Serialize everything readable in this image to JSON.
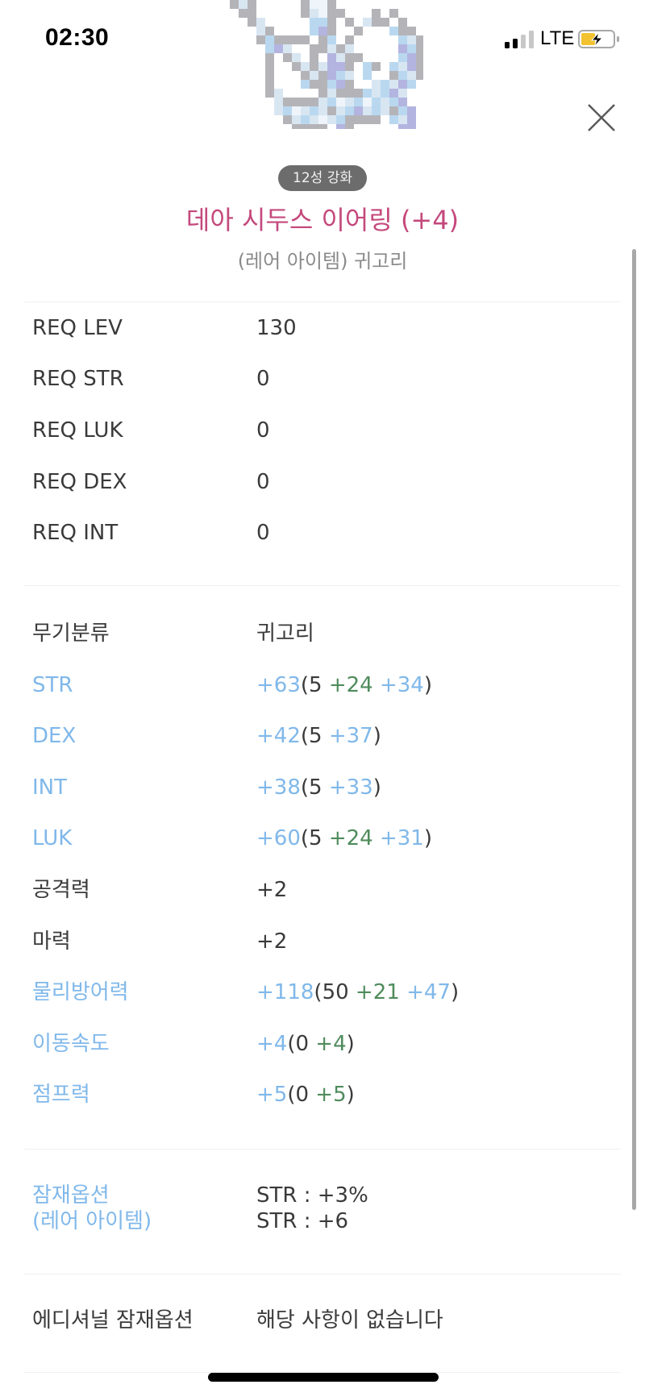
{
  "status_bar": {
    "time": "02:30",
    "network": "LTE",
    "signal_bars_active": 2,
    "signal_bars_total": 4,
    "battery_state": "charging"
  },
  "item": {
    "image_icon": "pixel-earring-icon",
    "enhance_badge": "12성 강화",
    "name": "데아 시두스 이어링 (+4)",
    "subtitle": "(레어 아이템) 귀고리"
  },
  "close_icon": "close-x-icon",
  "requirements": [
    {
      "label": "REQ LEV",
      "value": "130"
    },
    {
      "label": "REQ STR",
      "value": "0"
    },
    {
      "label": "REQ LUK",
      "value": "0"
    },
    {
      "label": "REQ DEX",
      "value": "0"
    },
    {
      "label": "REQ INT",
      "value": "0"
    }
  ],
  "stats": [
    {
      "label": "무기분류",
      "label_color": "dark",
      "parts": [
        {
          "text": "귀고리",
          "color": "dark"
        }
      ]
    },
    {
      "label": "STR",
      "label_color": "blue",
      "parts": [
        {
          "text": "+63",
          "color": "blue"
        },
        {
          "text": "(5 ",
          "color": "dark"
        },
        {
          "text": "+24",
          "color": "green"
        },
        {
          "text": " ",
          "color": "dark"
        },
        {
          "text": "+34",
          "color": "blue"
        },
        {
          "text": ")",
          "color": "dark"
        }
      ]
    },
    {
      "label": "DEX",
      "label_color": "blue",
      "parts": [
        {
          "text": "+42",
          "color": "blue"
        },
        {
          "text": "(5 ",
          "color": "dark"
        },
        {
          "text": "+37",
          "color": "blue"
        },
        {
          "text": ")",
          "color": "dark"
        }
      ]
    },
    {
      "label": "INT",
      "label_color": "blue",
      "parts": [
        {
          "text": "+38",
          "color": "blue"
        },
        {
          "text": "(5 ",
          "color": "dark"
        },
        {
          "text": "+33",
          "color": "blue"
        },
        {
          "text": ")",
          "color": "dark"
        }
      ]
    },
    {
      "label": "LUK",
      "label_color": "blue",
      "parts": [
        {
          "text": "+60",
          "color": "blue"
        },
        {
          "text": "(5 ",
          "color": "dark"
        },
        {
          "text": "+24",
          "color": "green"
        },
        {
          "text": " ",
          "color": "dark"
        },
        {
          "text": "+31",
          "color": "blue"
        },
        {
          "text": ")",
          "color": "dark"
        }
      ]
    },
    {
      "label": "공격력",
      "label_color": "dark",
      "parts": [
        {
          "text": "+2",
          "color": "dark"
        }
      ]
    },
    {
      "label": "마력",
      "label_color": "dark",
      "parts": [
        {
          "text": "+2",
          "color": "dark"
        }
      ]
    },
    {
      "label": "물리방어력",
      "label_color": "blue",
      "parts": [
        {
          "text": "+118",
          "color": "blue"
        },
        {
          "text": "(50 ",
          "color": "dark"
        },
        {
          "text": "+21",
          "color": "green"
        },
        {
          "text": " ",
          "color": "dark"
        },
        {
          "text": "+47",
          "color": "blue"
        },
        {
          "text": ")",
          "color": "dark"
        }
      ]
    },
    {
      "label": "이동속도",
      "label_color": "blue",
      "parts": [
        {
          "text": "+4",
          "color": "blue"
        },
        {
          "text": "(0 ",
          "color": "dark"
        },
        {
          "text": "+4",
          "color": "green"
        },
        {
          "text": ")",
          "color": "dark"
        }
      ]
    },
    {
      "label": "점프력",
      "label_color": "blue",
      "parts": [
        {
          "text": "+5",
          "color": "blue"
        },
        {
          "text": "(0 ",
          "color": "dark"
        },
        {
          "text": "+5",
          "color": "green"
        },
        {
          "text": ")",
          "color": "dark"
        }
      ]
    }
  ],
  "potential": {
    "label_line1": "잠재옵션",
    "label_line2": "(레어 아이템)",
    "lines": [
      "STR : +3%",
      "STR : +6"
    ]
  },
  "additional_potential": {
    "label": "에디셔널 잠재옵션",
    "value": "해당 사항이 없습니다"
  },
  "colors": {
    "title": "#c4497c",
    "blue": "#80b8ea",
    "green": "#4f8c5c",
    "red": "#e23b3b",
    "dark": "#3a3a3a",
    "badge_bg": "#6c6c6c"
  }
}
